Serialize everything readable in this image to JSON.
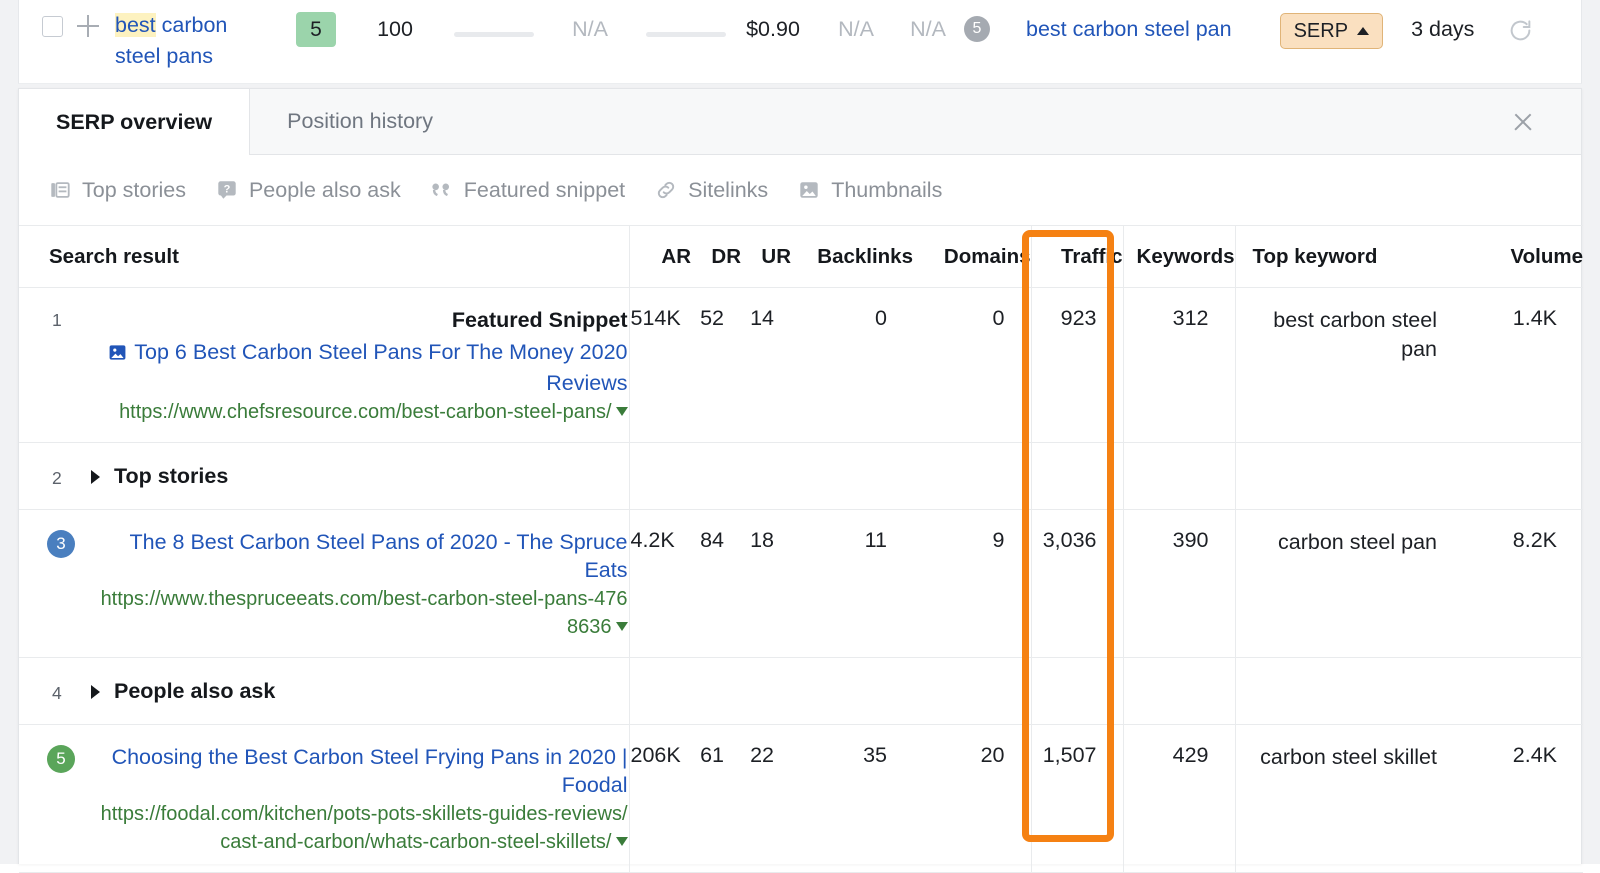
{
  "keyword_row": {
    "checkbox_checked": false,
    "add_icon": "plus-icon",
    "keyword_highlight": "best",
    "keyword_rest": " carbon steel pans",
    "position": "5",
    "volume": "100",
    "kd": "N/A",
    "cpc": "$0.90",
    "traffic": "N/A",
    "paid": "N/A",
    "sf_count": "5",
    "top_keyword": "best carbon steel pan",
    "serp_button": "SERP",
    "updated": "3 days",
    "refresh_icon": "refresh-icon"
  },
  "panel": {
    "tabs": [
      {
        "label": "SERP overview",
        "active": true
      },
      {
        "label": "Position history",
        "active": false
      }
    ],
    "close_icon": "close-icon",
    "features": [
      {
        "label": "Top stories",
        "icon": "top-stories-icon"
      },
      {
        "label": "People also ask",
        "icon": "people-also-ask-icon"
      },
      {
        "label": "Featured snippet",
        "icon": "quote-icon"
      },
      {
        "label": "Sitelinks",
        "icon": "link-icon"
      },
      {
        "label": "Thumbnails",
        "icon": "image-icon"
      }
    ],
    "table": {
      "headers": [
        "Search result",
        "AR",
        "DR",
        "UR",
        "Backlinks",
        "Domains",
        "Traffic",
        "Keywords",
        "Top keyword",
        "Volume"
      ],
      "highlighted_column": "Traffic",
      "highlight_color": "#f58113",
      "rows": [
        {
          "type": "result",
          "rank": "1",
          "rank_style": "plain",
          "feature_label": "Featured Snippet",
          "title_icon": "thumbnail-icon",
          "title": "Top 6 Best Carbon Steel Pans For The Money 2020 Reviews",
          "url": "https://www.chefsresource.com/best-carbon-steel-pans/",
          "ar": "514K",
          "dr": "52",
          "ur": "14",
          "backlinks": "0",
          "domains": "0",
          "traffic": "923",
          "keywords": "312",
          "top_keyword": "best carbon steel pan",
          "volume": "1.4K"
        },
        {
          "type": "group",
          "rank": "2",
          "label": "Top stories"
        },
        {
          "type": "result",
          "rank": "3",
          "rank_style": "blue",
          "title": "The 8 Best Carbon Steel Pans of 2020 - The Spruce Eats",
          "url": "https://www.thespruceeats.com/best-carbon-steel-pans-4768636",
          "ar": "4.2K",
          "dr": "84",
          "ur": "18",
          "backlinks": "11",
          "domains": "9",
          "traffic": "3,036",
          "keywords": "390",
          "top_keyword": "carbon steel pan",
          "volume": "8.2K"
        },
        {
          "type": "group",
          "rank": "4",
          "label": "People also ask"
        },
        {
          "type": "result",
          "rank": "5",
          "rank_style": "green",
          "title": "Choosing the Best Carbon Steel Frying Pans in 2020 | Foodal",
          "url": "https://foodal.com/kitchen/pots-pots-skillets-guides-reviews/cast-and-carbon/whats-carbon-steel-skillets/",
          "ar": "206K",
          "dr": "61",
          "ur": "22",
          "backlinks": "35",
          "domains": "20",
          "traffic": "1,507",
          "keywords": "429",
          "top_keyword": "carbon steel skillet",
          "volume": "2.4K"
        }
      ]
    }
  }
}
